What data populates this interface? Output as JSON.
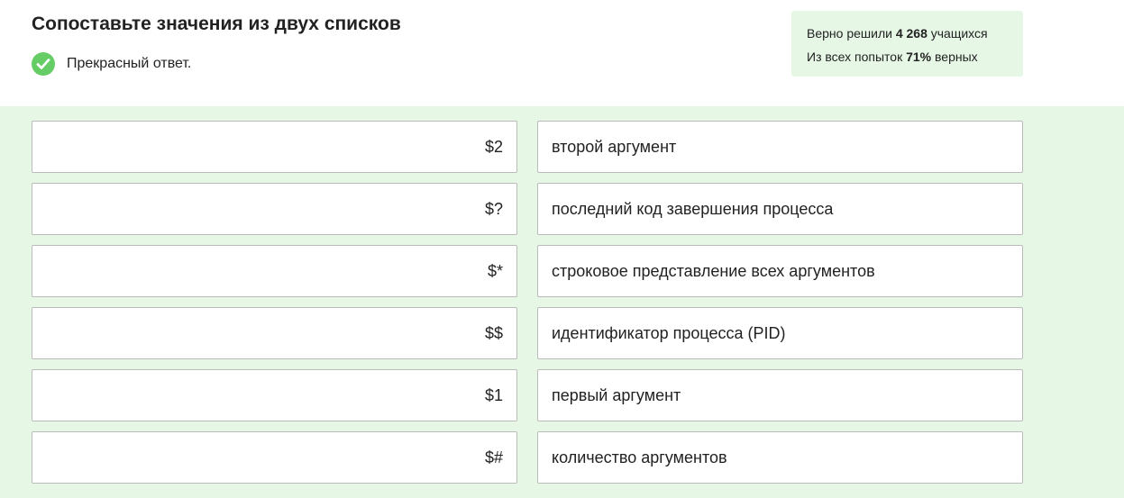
{
  "task": {
    "title": "Сопоставьте значения из двух списков",
    "status_text": "Прекрасный ответ."
  },
  "stats": {
    "line1_prefix": "Верно решили ",
    "solved_count": "4 268",
    "line1_suffix": " учащихся",
    "line2_prefix": "Из всех попыток ",
    "percent": "71%",
    "line2_suffix": " верных"
  },
  "matching": {
    "left": [
      "$2",
      "$?",
      "$*",
      "$$",
      "$1",
      "$#"
    ],
    "right": [
      "второй аргумент",
      "последний код завершения процесса",
      "строковое представление всех аргументов",
      "идентификатор процесса (PID)",
      "первый аргумент",
      "количество аргументов"
    ]
  },
  "colors": {
    "accent_green": "#66cc66",
    "panel_background": "#e6f7e6"
  }
}
